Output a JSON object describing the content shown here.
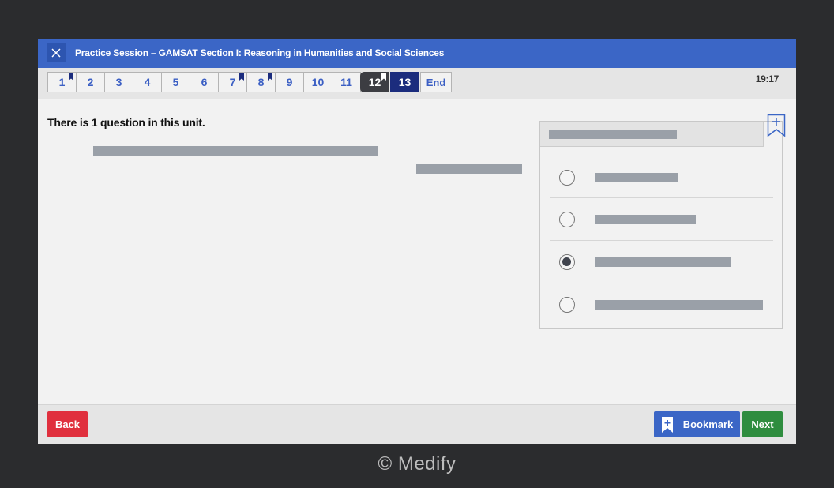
{
  "window": {
    "title": "Practice Session – GAMSAT Section I: Reasoning in Humanities and Social Sciences",
    "close_icon": "close-icon"
  },
  "navigation": {
    "questions": [
      {
        "label": "1",
        "flagged": true,
        "state": "default"
      },
      {
        "label": "2",
        "flagged": false,
        "state": "default"
      },
      {
        "label": "3",
        "flagged": false,
        "state": "default"
      },
      {
        "label": "4",
        "flagged": false,
        "state": "default"
      },
      {
        "label": "5",
        "flagged": false,
        "state": "default"
      },
      {
        "label": "6",
        "flagged": false,
        "state": "default"
      },
      {
        "label": "7",
        "flagged": true,
        "state": "default"
      },
      {
        "label": "8",
        "flagged": true,
        "state": "default"
      },
      {
        "label": "9",
        "flagged": false,
        "state": "default"
      },
      {
        "label": "10",
        "flagged": false,
        "state": "default"
      },
      {
        "label": "11",
        "flagged": false,
        "state": "default"
      },
      {
        "label": "12",
        "flagged": true,
        "state": "reviewed"
      },
      {
        "label": "13",
        "flagged": false,
        "state": "current"
      }
    ],
    "end_label": "End",
    "timer": "19:17"
  },
  "content": {
    "unit_text": "There is 1 question in this unit.",
    "selected_option": 3,
    "option_count": 4
  },
  "footer": {
    "back_label": "Back",
    "bookmark_label": "Bookmark",
    "next_label": "Next"
  },
  "colors": {
    "titlebar": "#3b66c6",
    "current_question": "#1b2c7d",
    "back_button": "#e0303e",
    "next_button": "#2f8d3f",
    "background": "#2b2c2e"
  },
  "copyright": "© Medify"
}
